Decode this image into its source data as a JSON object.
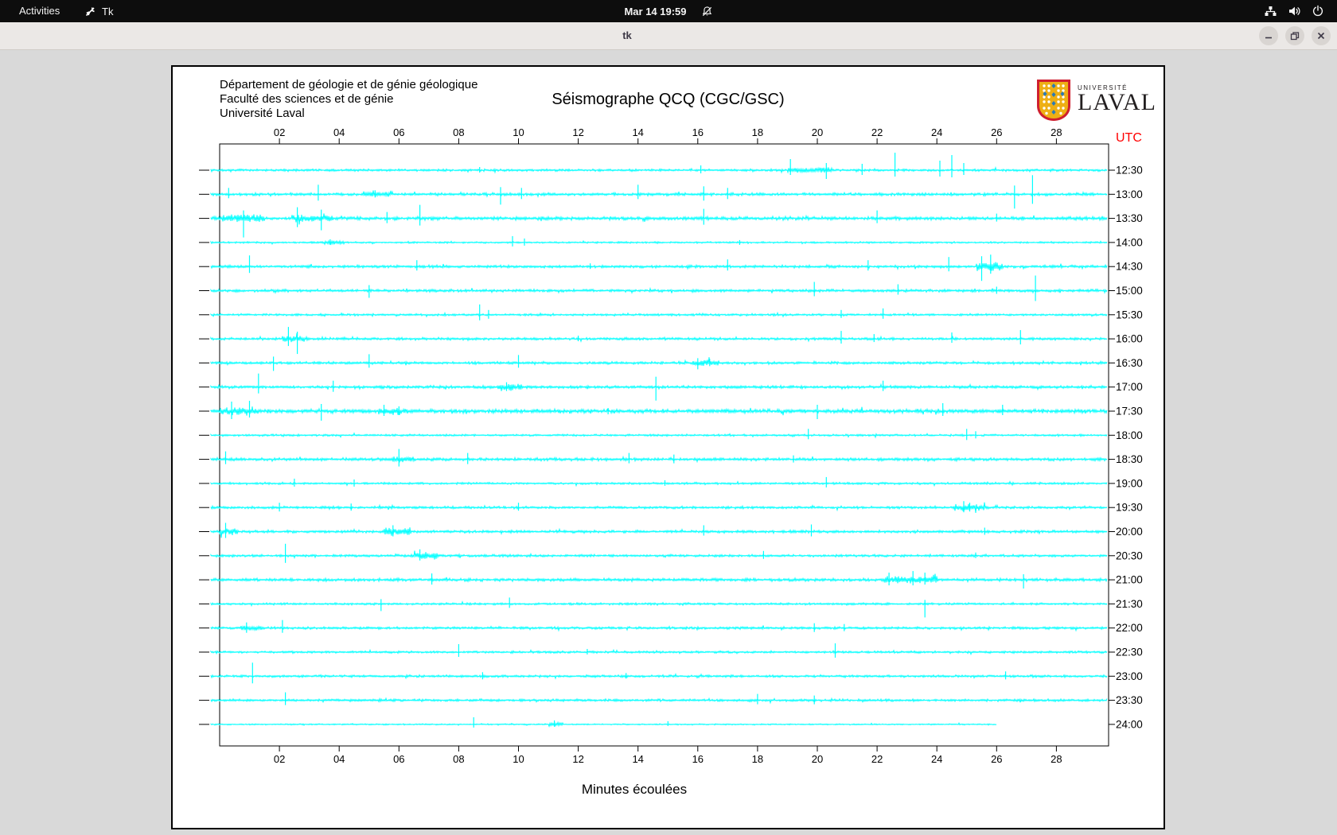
{
  "system_bar": {
    "activities_label": "Activities",
    "app_name": "Tk",
    "clock": "Mar 14 19:59",
    "icons": [
      "tk-app-icon",
      "notifications-muted-icon",
      "network-wired-icon",
      "volume-icon",
      "power-icon"
    ]
  },
  "window": {
    "title": "tk",
    "buttons": [
      "minimize",
      "maximize",
      "close"
    ]
  },
  "header": {
    "address_line1": "Département de géologie et de génie géologique",
    "address_line2": "Faculté des sciences et de génie",
    "address_line3": "Université Laval",
    "title": "Séismographe QCQ (CGC/GSC)"
  },
  "logo": {
    "line1": "UNIVERSITÉ",
    "line2": "LAVAL",
    "shield_red": "#cf1f2f",
    "shield_gold": "#eeaf14",
    "shield_blue": "#2a7ab8"
  },
  "chart_data": {
    "type": "line",
    "title": "Séismographe QCQ (CGC/GSC)",
    "xlabel": "Minutes écoulées",
    "right_axis_label": "UTC",
    "utc_color": "#ff0000",
    "trace_color": "#00ffff",
    "axis_color": "#000000",
    "xlim": [
      0,
      29.7
    ],
    "x_tick_labels": [
      "02",
      "04",
      "06",
      "08",
      "10",
      "12",
      "14",
      "16",
      "18",
      "20",
      "22",
      "24",
      "26",
      "28"
    ],
    "x_tick_minutes": [
      2,
      4,
      6,
      8,
      10,
      12,
      14,
      16,
      18,
      20,
      22,
      24,
      26,
      28
    ],
    "grid": false,
    "rows": [
      {
        "label": "12:30",
        "n": 1.6,
        "end": 29.7,
        "s": [
          [
            8.7,
            4,
            3
          ],
          [
            16.1,
            6,
            4
          ],
          [
            19.1,
            14,
            6
          ],
          [
            20.3,
            9,
            11
          ],
          [
            21.5,
            8,
            6
          ],
          [
            22.6,
            22,
            8
          ],
          [
            24.1,
            12,
            8
          ],
          [
            24.5,
            19,
            9
          ],
          [
            24.9,
            9,
            6
          ]
        ],
        "b": [
          [
            19.0,
            1.5,
            2.5
          ]
        ]
      },
      {
        "label": "13:00",
        "n": 2.0,
        "end": 29.7,
        "s": [
          [
            0.3,
            8,
            5
          ],
          [
            3.3,
            12,
            8
          ],
          [
            5.2,
            5,
            4
          ],
          [
            9.4,
            9,
            13
          ],
          [
            10.1,
            8,
            6
          ],
          [
            14.0,
            12,
            6
          ],
          [
            16.2,
            10,
            8
          ],
          [
            17.0,
            8,
            6
          ],
          [
            26.6,
            11,
            18
          ],
          [
            27.2,
            24,
            12
          ]
        ],
        "b": [
          [
            4.8,
            1.0,
            2.5
          ]
        ]
      },
      {
        "label": "13:30",
        "n": 2.4,
        "end": 29.7,
        "s": [
          [
            0.8,
            10,
            24
          ],
          [
            2.6,
            14,
            11
          ],
          [
            3.4,
            11,
            15
          ],
          [
            5.6,
            8,
            6
          ],
          [
            6.7,
            17,
            9
          ],
          [
            16.2,
            12,
            8
          ],
          [
            22.0,
            10,
            6
          ],
          [
            26.0,
            6,
            4
          ]
        ],
        "b": [
          [
            0.1,
            1.4,
            4
          ],
          [
            2.4,
            1.4,
            3
          ]
        ]
      },
      {
        "label": "14:00",
        "n": 1.2,
        "end": 29.7,
        "s": [
          [
            3.7,
            4,
            3
          ],
          [
            9.8,
            8,
            5
          ],
          [
            10.2,
            5,
            4
          ],
          [
            17.4,
            3,
            3
          ]
        ],
        "b": [
          [
            3.5,
            0.7,
            2
          ]
        ]
      },
      {
        "label": "14:30",
        "n": 1.9,
        "end": 29.7,
        "s": [
          [
            1.0,
            14,
            8
          ],
          [
            6.6,
            8,
            5
          ],
          [
            12.4,
            4,
            3
          ],
          [
            17.0,
            9,
            5
          ],
          [
            21.7,
            8,
            5
          ],
          [
            24.4,
            12,
            6
          ],
          [
            25.5,
            13,
            18
          ],
          [
            25.8,
            15,
            9
          ]
        ],
        "b": [
          [
            25.3,
            0.9,
            5
          ]
        ]
      },
      {
        "label": "15:00",
        "n": 1.9,
        "end": 29.7,
        "s": [
          [
            5.0,
            7,
            9
          ],
          [
            19.9,
            11,
            7
          ],
          [
            22.7,
            8,
            5
          ],
          [
            26.0,
            5,
            4
          ],
          [
            27.3,
            19,
            13
          ]
        ],
        "b": []
      },
      {
        "label": "15:30",
        "n": 1.5,
        "end": 29.7,
        "s": [
          [
            8.7,
            13,
            7
          ],
          [
            9.0,
            6,
            5
          ],
          [
            20.8,
            6,
            4
          ],
          [
            22.2,
            8,
            5
          ]
        ],
        "b": []
      },
      {
        "label": "16:00",
        "n": 1.8,
        "end": 29.7,
        "s": [
          [
            2.3,
            15,
            9
          ],
          [
            2.6,
            9,
            19
          ],
          [
            12.0,
            4,
            3
          ],
          [
            20.8,
            10,
            6
          ],
          [
            21.9,
            6,
            4
          ],
          [
            24.5,
            8,
            5
          ],
          [
            26.8,
            11,
            7
          ]
        ],
        "b": [
          [
            2.1,
            0.9,
            3
          ]
        ]
      },
      {
        "label": "16:30",
        "n": 1.8,
        "end": 29.7,
        "s": [
          [
            1.8,
            8,
            10
          ],
          [
            5.0,
            11,
            6
          ],
          [
            10.0,
            10,
            6
          ],
          [
            16.0,
            6,
            8
          ],
          [
            16.4,
            5,
            4
          ]
        ],
        "b": [
          [
            15.8,
            0.9,
            3
          ]
        ]
      },
      {
        "label": "17:00",
        "n": 2.0,
        "end": 29.7,
        "s": [
          [
            1.3,
            17,
            8
          ],
          [
            3.8,
            8,
            6
          ],
          [
            9.6,
            6,
            5
          ],
          [
            14.6,
            13,
            17
          ],
          [
            22.2,
            8,
            5
          ]
        ],
        "b": [
          [
            9.3,
            0.8,
            3
          ]
        ]
      },
      {
        "label": "17:30",
        "n": 2.8,
        "end": 29.7,
        "s": [
          [
            0.4,
            12,
            10
          ],
          [
            1.0,
            13,
            8
          ],
          [
            3.4,
            9,
            12
          ],
          [
            5.5,
            8,
            6
          ],
          [
            6.0,
            6,
            5
          ],
          [
            13.0,
            4,
            4
          ],
          [
            20.0,
            8,
            10
          ],
          [
            24.2,
            10,
            6
          ],
          [
            26.2,
            8,
            5
          ]
        ],
        "b": [
          [
            0.0,
            1.3,
            4
          ],
          [
            5.3,
            1.0,
            3
          ]
        ]
      },
      {
        "label": "18:00",
        "n": 1.4,
        "end": 29.7,
        "s": [
          [
            19.7,
            8,
            5
          ],
          [
            25.0,
            8,
            6
          ],
          [
            25.3,
            5,
            4
          ]
        ],
        "b": []
      },
      {
        "label": "18:30",
        "n": 2.1,
        "end": 29.7,
        "s": [
          [
            0.2,
            10,
            6
          ],
          [
            6.0,
            13,
            9
          ],
          [
            8.3,
            8,
            6
          ],
          [
            13.7,
            8,
            5
          ],
          [
            15.2,
            6,
            5
          ],
          [
            19.2,
            5,
            4
          ]
        ],
        "b": [
          [
            5.8,
            0.7,
            3
          ]
        ]
      },
      {
        "label": "19:00",
        "n": 1.5,
        "end": 29.7,
        "s": [
          [
            2.5,
            6,
            4
          ],
          [
            4.5,
            5,
            4
          ],
          [
            14.9,
            4,
            3
          ],
          [
            20.3,
            8,
            5
          ]
        ],
        "b": []
      },
      {
        "label": "19:30",
        "n": 1.7,
        "end": 29.7,
        "s": [
          [
            2.0,
            6,
            5
          ],
          [
            4.4,
            5,
            4
          ],
          [
            10.0,
            6,
            4
          ],
          [
            24.9,
            8,
            6
          ],
          [
            25.1,
            6,
            5
          ]
        ],
        "b": [
          [
            24.6,
            1.0,
            4
          ]
        ]
      },
      {
        "label": "20:00",
        "n": 1.9,
        "end": 29.7,
        "s": [
          [
            0.2,
            11,
            8
          ],
          [
            5.8,
            8,
            6
          ],
          [
            16.2,
            8,
            5
          ],
          [
            19.8,
            9,
            6
          ],
          [
            25.6,
            5,
            4
          ]
        ],
        "b": [
          [
            5.5,
            0.9,
            4
          ],
          [
            0.0,
            0.6,
            3
          ]
        ]
      },
      {
        "label": "20:30",
        "n": 1.7,
        "end": 29.7,
        "s": [
          [
            2.2,
            15,
            9
          ],
          [
            6.7,
            8,
            6
          ],
          [
            18.2,
            6,
            4
          ],
          [
            25.3,
            4,
            3
          ]
        ],
        "b": [
          [
            6.5,
            0.8,
            4
          ]
        ]
      },
      {
        "label": "21:00",
        "n": 2.1,
        "end": 29.7,
        "s": [
          [
            7.1,
            8,
            6
          ],
          [
            22.4,
            9,
            7
          ],
          [
            23.2,
            11,
            7
          ],
          [
            23.6,
            9,
            6
          ],
          [
            26.9,
            7,
            11
          ]
        ],
        "b": [
          [
            22.2,
            1.8,
            4
          ]
        ]
      },
      {
        "label": "21:30",
        "n": 1.5,
        "end": 29.7,
        "s": [
          [
            5.4,
            6,
            9
          ],
          [
            9.7,
            8,
            5
          ],
          [
            23.6,
            5,
            17
          ]
        ],
        "b": []
      },
      {
        "label": "22:00",
        "n": 1.7,
        "end": 29.7,
        "s": [
          [
            0.9,
            7,
            6
          ],
          [
            2.1,
            10,
            6
          ],
          [
            19.9,
            6,
            5
          ],
          [
            20.9,
            5,
            4
          ]
        ],
        "b": [
          [
            0.7,
            0.7,
            3
          ]
        ]
      },
      {
        "label": "22:30",
        "n": 1.5,
        "end": 29.7,
        "s": [
          [
            8.0,
            10,
            6
          ],
          [
            12.3,
            4,
            3
          ],
          [
            20.6,
            11,
            7
          ]
        ],
        "b": []
      },
      {
        "label": "23:00",
        "n": 1.7,
        "end": 29.7,
        "s": [
          [
            1.1,
            17,
            9
          ],
          [
            8.8,
            5,
            4
          ],
          [
            13.6,
            4,
            3
          ],
          [
            26.3,
            6,
            4
          ]
        ],
        "b": []
      },
      {
        "label": "23:30",
        "n": 1.7,
        "end": 29.7,
        "s": [
          [
            2.2,
            10,
            6
          ],
          [
            18.0,
            8,
            5
          ],
          [
            19.9,
            6,
            5
          ]
        ],
        "b": []
      },
      {
        "label": "24:00",
        "n": 0.9,
        "end": 26.0,
        "s": [
          [
            8.5,
            9,
            4
          ],
          [
            11.2,
            5,
            3
          ],
          [
            15.0,
            4,
            2
          ]
        ],
        "b": [
          [
            11.0,
            0.5,
            2
          ]
        ]
      }
    ]
  }
}
